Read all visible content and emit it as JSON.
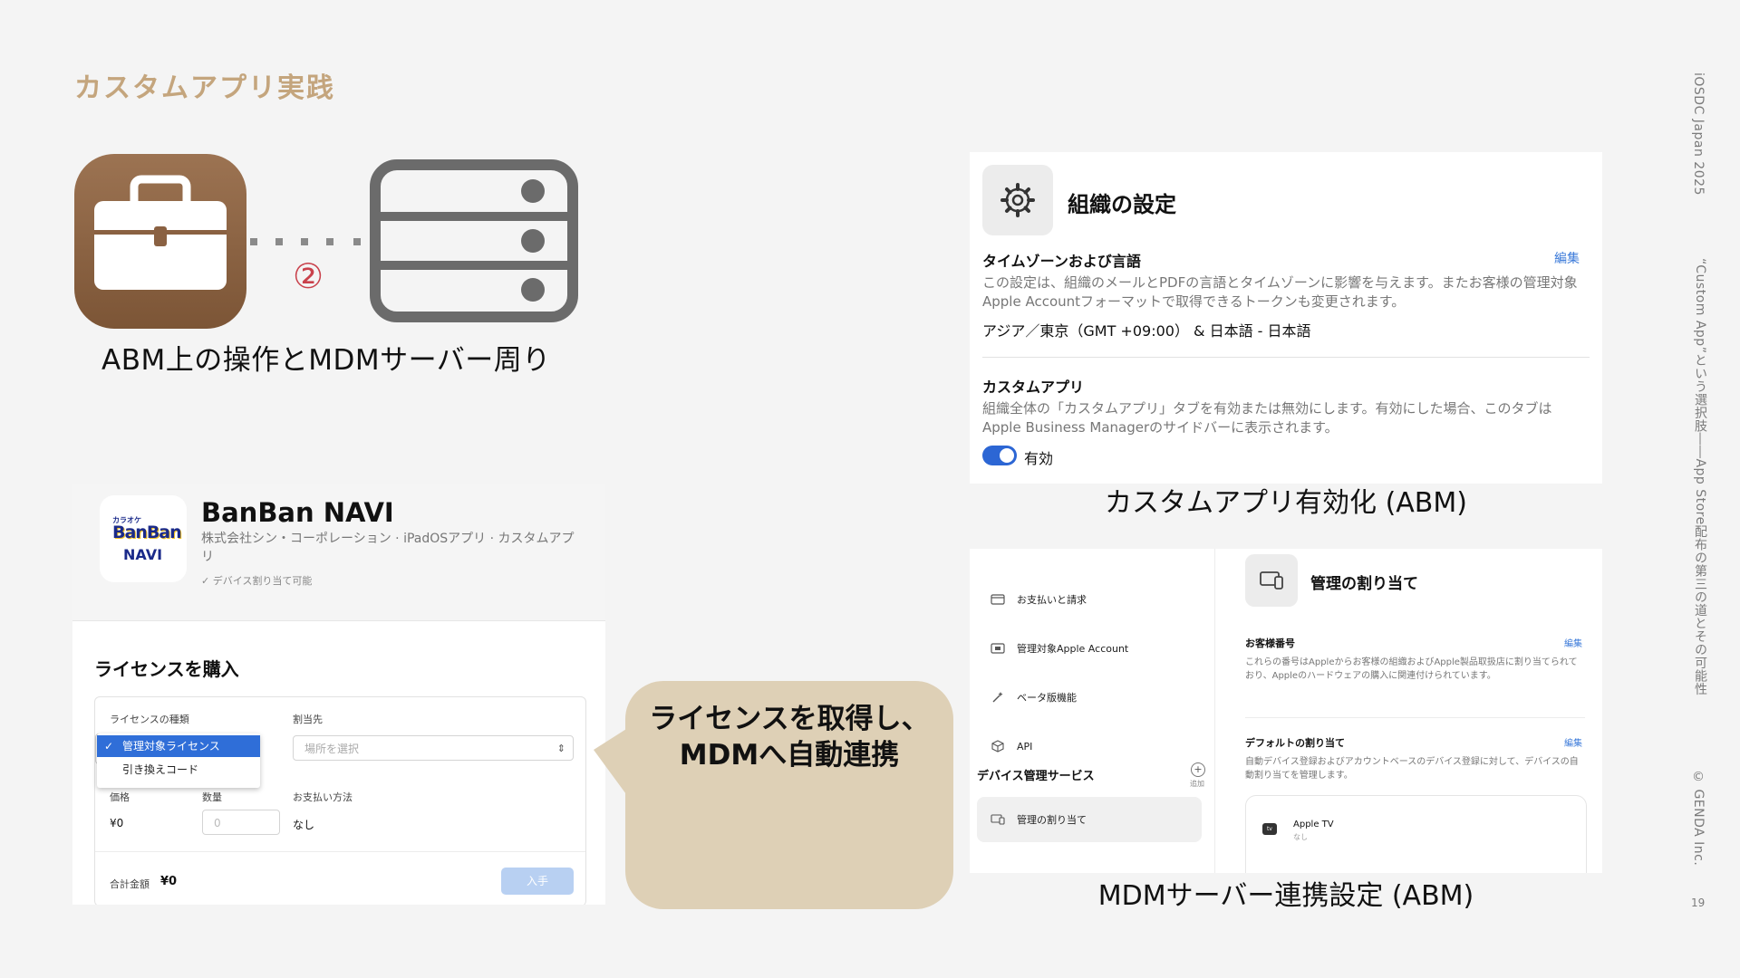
{
  "slide": {
    "title": "カスタムアプリ実践",
    "event": "iOSDC Japan 2025",
    "talk_title": "“Custom App”という選択肢――App Store配布の第三の道とその可能性",
    "copyright": "© GENDA Inc.",
    "page_number": "19"
  },
  "diagram": {
    "step_number": "②",
    "caption": "ABM上の操作とMDMサーバー周り",
    "left_icon": "briefcase-icon",
    "right_icon": "server-icon"
  },
  "org_settings": {
    "title": "組織の設定",
    "timezone": {
      "heading": "タイムゾーンおよび言語",
      "edit": "編集",
      "description": "この設定は、組織のメールとPDFの言語とタイムゾーンに影響を与えます。またお客様の管理対象Apple Accountフォーマットで取得できるトークンも変更されます。",
      "value": "アジア／東京（GMT +09:00） & 日本語 - 日本語"
    },
    "custom_apps": {
      "heading": "カスタムアプリ",
      "description": "組織全体の「カスタムアプリ」タブを有効または無効にします。有効にした場合、このタブはApple Business Managerのサイドバーに表示されます。",
      "toggle_label": "有効",
      "enabled": true
    },
    "caption": "カスタムアプリ有効化 (ABM)"
  },
  "mdm": {
    "sidebar": {
      "items": [
        {
          "label": "お支払いと請求",
          "icon": "card-icon"
        },
        {
          "label": "管理対象Apple Account",
          "icon": "id-card-icon"
        },
        {
          "label": "ベータ版機能",
          "icon": "magic-wand-icon"
        },
        {
          "label": "API",
          "icon": "cube-icon"
        }
      ],
      "section_heading": "デバイス管理サービス",
      "add_label": "追加",
      "active_item": "管理の割り当て"
    },
    "title": "管理の割り当て",
    "customer_number": {
      "heading": "お客様番号",
      "edit": "編集",
      "description": "これらの番号はAppleからお客様の組織およびApple製品取扱店に割り当てられており、Appleのハードウェアの購入に関連付けられています。"
    },
    "default_assignment": {
      "heading": "デフォルトの割り当て",
      "edit": "編集",
      "description": "自動デバイス登録およびアカウントベースのデバイス登録に対して、デバイスの自動割り当てを管理します。"
    },
    "device": {
      "name": "Apple TV",
      "value": "なし",
      "icon_text": "tv"
    },
    "caption": "MDMサーバー連携設定 (ABM)"
  },
  "app": {
    "logo": {
      "top": "カラオケ",
      "mid": "BanBan",
      "bot": "NAVI"
    },
    "name": "BanBan NAVI",
    "subtitle": "株式会社シン・コーポレーション · iPadOSアプリ · カスタムアプリ",
    "device_assignable": "✓ デバイス割り当て可能",
    "purchase": {
      "title": "ライセンスを購入",
      "license_type_label": "ライセンスの種類",
      "assign_label": "割当先",
      "assign_placeholder": "場所を選択",
      "license_options": [
        "管理対象ライセンス",
        "引き換えコード"
      ],
      "selected_option": "管理対象ライセンス",
      "price_label": "価格",
      "quantity_label": "数量",
      "payment_label": "お支払い方法",
      "price_value": "¥0",
      "quantity_placeholder": "0",
      "payment_value": "なし",
      "total_label": "合計金額",
      "total_value": "¥0",
      "buy_label": "入手"
    }
  },
  "bubble": {
    "line1": "ライセンスを取得し、",
    "line2": "MDMへ自動連携"
  },
  "colors": {
    "title_accent": "#c4a57d",
    "app_icon_brown": "#8a6142",
    "server_gray": "#6b6b6b",
    "step_red": "#c9414b",
    "link_blue": "#3b7ad9",
    "toggle_blue": "#2c66d4",
    "bubble_beige": "#ded0b6"
  }
}
